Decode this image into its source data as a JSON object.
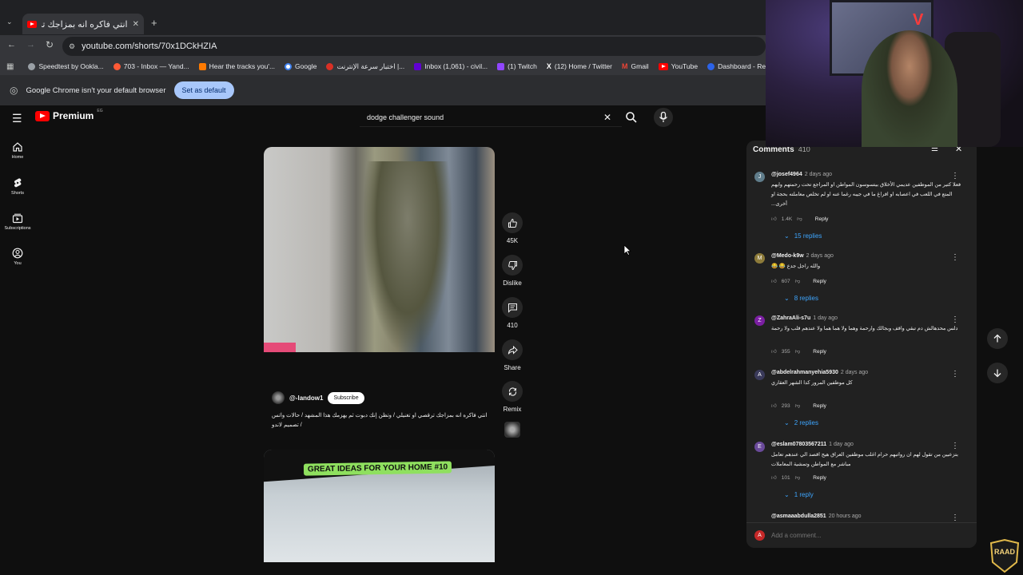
{
  "browser": {
    "tab_title": "انتي فاكره انه بمزاجك ترقصي او تـ",
    "url": "youtube.com/shorts/70x1DCkHZIA",
    "bookmarks": [
      {
        "label": "Speedtest by Ookla...",
        "color": "#9aa0a6"
      },
      {
        "label": "703 - Inbox — Yand...",
        "color": "#ff5a36"
      },
      {
        "label": "Hear the tracks you'...",
        "color": "#ff7a00"
      },
      {
        "label": "Google",
        "color": "#4285f4"
      },
      {
        "label": "اختبار سرعة الإنترنت |...",
        "color": "#d93025"
      },
      {
        "label": "Inbox (1,061) - civil...",
        "color": "#6001d2"
      },
      {
        "label": "(1) Twitch",
        "color": "#9146ff"
      },
      {
        "label": "(12) Home / Twitter",
        "color": "#ffffff"
      },
      {
        "label": "Gmail",
        "color": "#ea4335"
      },
      {
        "label": "YouTube",
        "color": "#ff0000"
      },
      {
        "label": "Dashboard - Restre...",
        "color": "#2c63e8"
      }
    ],
    "infobar_text": "Google Chrome isn't your default browser",
    "set_default_label": "Set as default"
  },
  "youtube": {
    "brand": "Premium",
    "region": "EG",
    "search_value": "dodge challenger sound",
    "nav": [
      {
        "label": "Home",
        "icon": "home-icon"
      },
      {
        "label": "Shorts",
        "icon": "shorts-icon"
      },
      {
        "label": "Subscriptions",
        "icon": "subscriptions-icon"
      },
      {
        "label": "You",
        "icon": "you-icon"
      }
    ],
    "short1": {
      "channel": "@-landow1",
      "subscribe_label": "Subscribe",
      "description": "انتي فاكره انه بمزاجك ترقصي او تغنيلي / وتظن إنك دبوت ثم يهزمك هذا المشهد / حالات واتس / تصميم لاندو"
    },
    "actions": {
      "likes": "45K",
      "dislike": "Dislike",
      "comments": "410",
      "share": "Share",
      "remix": "Remix"
    },
    "short2": {
      "banner": "GREAT IDEAS FOR YOUR HOME #10"
    }
  },
  "comments": {
    "title": "Comments",
    "count": "410",
    "add_placeholder": "Add a comment...",
    "reply_label": "Reply",
    "items": [
      {
        "user": "@josef4964",
        "time": "2 days ago",
        "text": "فعلا كتير من الموظفين عديمي الأخلاق بيتسوسون المواطن او المراجع تحت رحمتهم وايهم المتع في اللعب في اعصابه او افراغ ما في جيبه رغما عنه او لم تخلص معاملته بحجة او أخرى...",
        "likes": "1.4K",
        "replies": "15 replies",
        "avatar": "J",
        "avatar_color": "#607d8b"
      },
      {
        "user": "@Medo-k9w",
        "time": "2 days ago",
        "text": "والله راجل جدع 😂 😂",
        "likes": "607",
        "replies": "8 replies",
        "avatar": "M",
        "avatar_color": "#8d7b3a"
      },
      {
        "user": "@ZahraAli-s7u",
        "time": "1 day ago",
        "text": "دلس محدهالش دم تبقي واقف وبجالك وارحمة وهما ولا هما هما ولا عندهم قلب ولا رحمة",
        "likes": "355",
        "replies": "",
        "avatar": "Z",
        "avatar_color": "#7b1fa2"
      },
      {
        "user": "@abdelrahmanyehia5930",
        "time": "2 days ago",
        "text": "كل موظفين المرور كدا الشهر العقاري",
        "likes": "293",
        "replies": "2 replies",
        "avatar": "A",
        "avatar_color": "#3a3a5a"
      },
      {
        "user": "@eslam07803567211",
        "time": "1 day ago",
        "text": "بتزعبين من تقول لهم ان رواتبهم حرام اغلب موظفين العراق هيج اقصد الي عندهم تعامل مباشر مع المواطن وتمشية المعاملات",
        "likes": "101",
        "replies": "1 reply",
        "avatar": "E",
        "avatar_color": "#6a4a9a"
      },
      {
        "user": "@asmaaabdulla2851",
        "time": "20 hours ago",
        "text": "",
        "likes": "",
        "replies": "",
        "avatar": "A",
        "avatar_color": "#c62828"
      }
    ]
  },
  "overlay": {
    "stream_logo": "RAAD"
  }
}
